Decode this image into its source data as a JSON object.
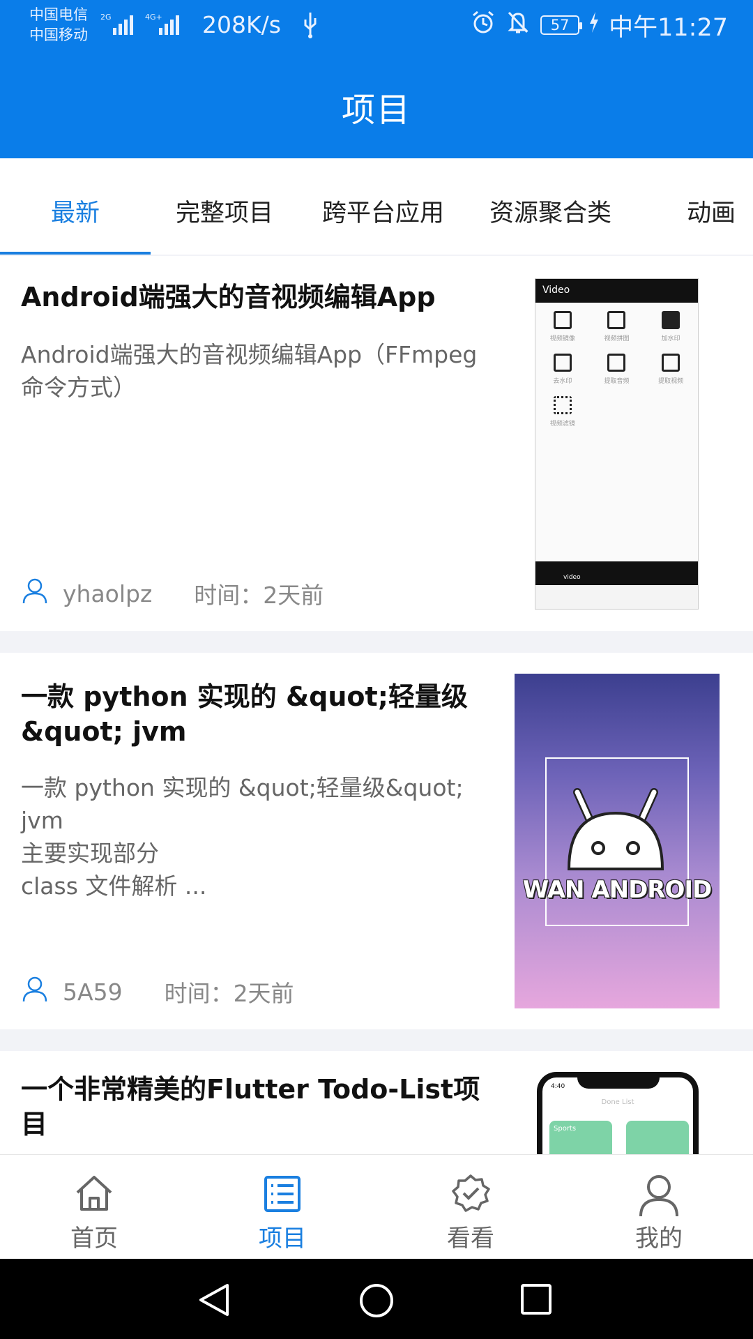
{
  "status_bar": {
    "carrier_1": "中国电信",
    "carrier_2": "中国移动",
    "network_1": "2G",
    "network_2": "4G+",
    "speed": "208K/s",
    "battery": "57",
    "time": "中午11:27"
  },
  "app_bar": {
    "title": "项目"
  },
  "tabs": [
    {
      "label": "最新",
      "active": true
    },
    {
      "label": "完整项目",
      "active": false
    },
    {
      "label": "跨平台应用",
      "active": false
    },
    {
      "label": "资源聚合类",
      "active": false
    },
    {
      "label": "动画",
      "active": false
    }
  ],
  "articles": [
    {
      "title": "Android端强大的音视频编辑App",
      "description": "Android端强大的音视频编辑App（FFmpeg 命令方式）",
      "author": "yhaolpz",
      "time": "时间：2天前",
      "thumbnail": {
        "header": "Video",
        "cells": [
          "视频镜像",
          "视频拼图",
          "加水印",
          "去水印",
          "提取音频",
          "提取视频",
          "视频滤镜"
        ],
        "bottom_label": "video"
      }
    },
    {
      "title": "一款 python 实现的 &quot;轻量级&quot; jvm",
      "description": "一款 python 实现的 &quot;轻量级&quot; jvm\n主要实现部分\nclass 文件解析 ...",
      "author": "5A59",
      "time": "时间：2天前",
      "thumbnail": {
        "caption": "WAN ANDROID"
      }
    },
    {
      "title": "一个非常精美的Flutter Todo-List项目",
      "thumbnail": {
        "clock": "4:40",
        "header": "Done List",
        "card_title": "Sports"
      }
    }
  ],
  "bottom_nav": [
    {
      "label": "首页",
      "icon": "home-icon",
      "active": false
    },
    {
      "label": "项目",
      "icon": "list-icon",
      "active": true
    },
    {
      "label": "看看",
      "icon": "badge-check-icon",
      "active": false
    },
    {
      "label": "我的",
      "icon": "person-icon",
      "active": false
    }
  ],
  "colors": {
    "primary": "#0a7de9",
    "accent": "#1a7fe0"
  }
}
